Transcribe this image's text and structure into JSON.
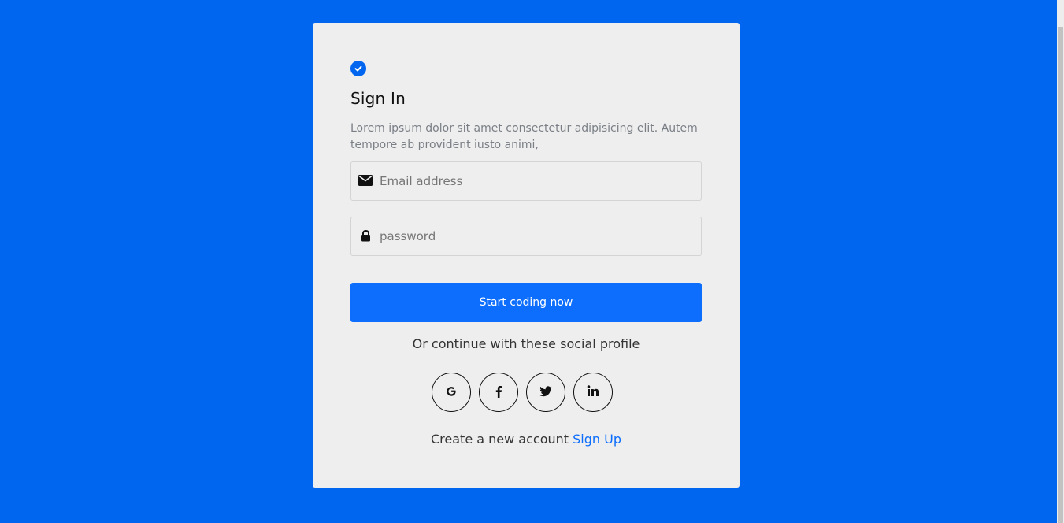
{
  "auth": {
    "title": "Sign In",
    "description": "Lorem ipsum dolor sit amet consectetur adipisicing elit. Autem tempore ab provident iusto animi,",
    "email_placeholder": "Email address",
    "password_placeholder": "password",
    "submit_label": "Start coding now",
    "social_prompt": "Or continue with these social profile",
    "create_account_text": "Create a new account",
    "signup_link_label": "Sign Up"
  },
  "social_buttons": [
    {
      "label": "G",
      "icon": "google-icon"
    },
    {
      "label": "f",
      "icon": "facebook-icon"
    },
    {
      "label": "twitter",
      "icon": "twitter-icon"
    },
    {
      "label": "in",
      "icon": "linkedin-icon"
    }
  ],
  "colors": {
    "page_background": "#0066f0",
    "card_background": "#eeeeee",
    "primary": "#0d6efd"
  }
}
